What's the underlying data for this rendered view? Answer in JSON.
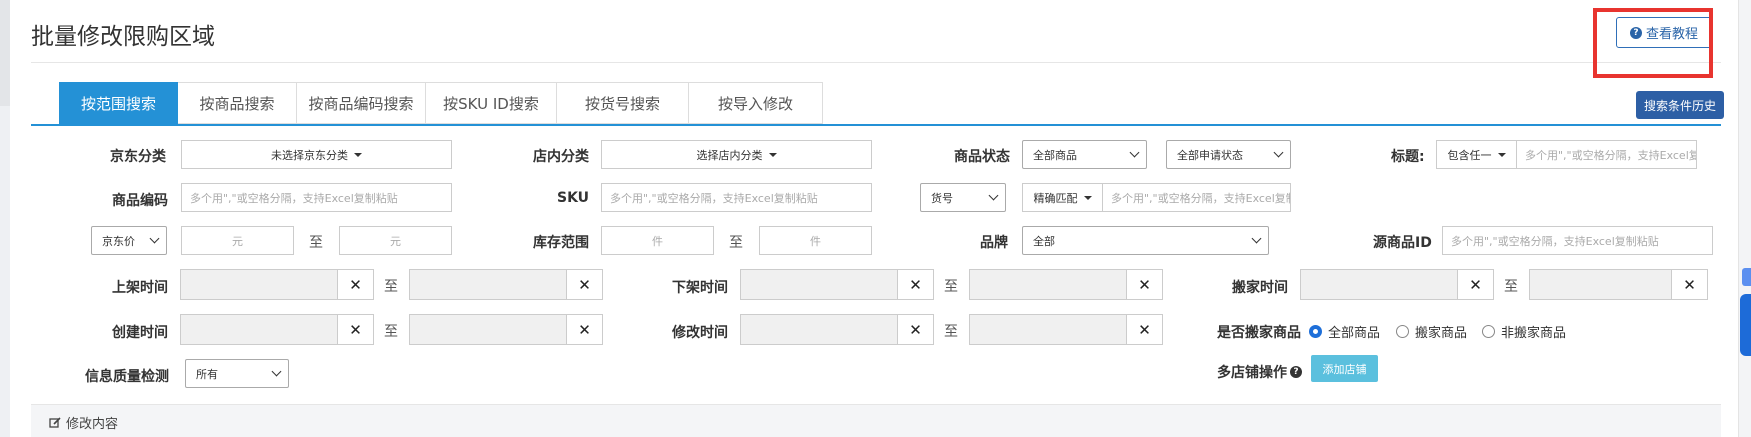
{
  "page": {
    "title": "批量修改限购区域",
    "tutorial_label": "查看教程",
    "history_label": "搜索条件历史",
    "footer_label": "修改内容"
  },
  "tabs": [
    {
      "label": "按范围搜索",
      "active": true
    },
    {
      "label": "按商品搜索"
    },
    {
      "label": "按商品编码搜索"
    },
    {
      "label": "按SKU ID搜索"
    },
    {
      "label": "按货号搜索"
    },
    {
      "label": "按导入修改"
    }
  ],
  "form": {
    "jd_category": {
      "label": "京东分类",
      "value": "未选择京东分类"
    },
    "shop_category": {
      "label": "店内分类",
      "value": "选择店内分类"
    },
    "product_status": {
      "label": "商品状态",
      "value": "全部商品",
      "apply_value": "全部申请状态"
    },
    "title": {
      "label": "标题:",
      "mode": "包含任一",
      "placeholder": "多个用\",\"或空格分隔，支持Excel复制粘贴"
    },
    "product_code": {
      "label": "商品编码",
      "placeholder": "多个用\",\"或空格分隔，支持Excel复制粘贴"
    },
    "sku": {
      "label": "SKU",
      "placeholder": "多个用\",\"或空格分隔，支持Excel复制粘贴"
    },
    "item_no": {
      "select": "货号",
      "match": "精确匹配",
      "placeholder": "多个用\",\"或空格分隔，支持Excel复制粘贴"
    },
    "price": {
      "select": "京东价",
      "min_placeholder": "元",
      "max_placeholder": "元"
    },
    "stock": {
      "label": "库存范围",
      "min_placeholder": "件",
      "max_placeholder": "件"
    },
    "brand": {
      "label": "品牌",
      "value": "全部"
    },
    "source_id": {
      "label": "源商品ID",
      "placeholder": "多个用\",\"或空格分隔，支持Excel复制粘贴"
    },
    "listed_time": {
      "label": "上架时间"
    },
    "delisted_time": {
      "label": "下架时间"
    },
    "move_time": {
      "label": "搬家时间"
    },
    "created_time": {
      "label": "创建时间"
    },
    "modified_time": {
      "label": "修改时间"
    },
    "is_moved": {
      "label": "是否搬家商品",
      "options": [
        "全部商品",
        "搬家商品",
        "非搬家商品"
      ]
    },
    "quality": {
      "label": "信息质量检测",
      "value": "所有"
    },
    "multi_shop": {
      "label": "多店铺操作",
      "button": "添加店铺"
    },
    "to": "至",
    "clear": "✕"
  }
}
